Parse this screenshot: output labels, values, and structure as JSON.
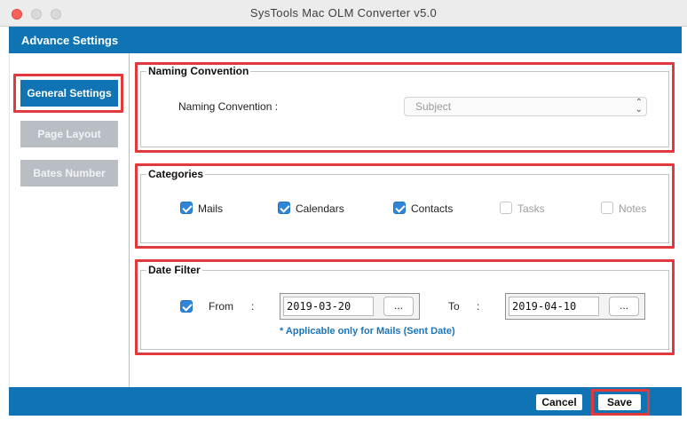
{
  "window": {
    "title": "SysTools Mac OLM Converter v5.0"
  },
  "header": {
    "title": "Advance Settings"
  },
  "sidebar": {
    "items": [
      {
        "label": "General Settings",
        "active": true
      },
      {
        "label": "Page Layout",
        "active": false
      },
      {
        "label": "Bates Number",
        "active": false
      }
    ]
  },
  "naming": {
    "group_title": "Naming Convention",
    "field_label": "Naming Convention :",
    "selected": "Subject"
  },
  "categories": {
    "group_title": "Categories",
    "items": [
      {
        "label": "Mails",
        "checked": true,
        "enabled": true
      },
      {
        "label": "Calendars",
        "checked": true,
        "enabled": true
      },
      {
        "label": "Contacts",
        "checked": true,
        "enabled": true
      },
      {
        "label": "Tasks",
        "checked": false,
        "enabled": false
      },
      {
        "label": "Notes",
        "checked": false,
        "enabled": false
      }
    ]
  },
  "date_filter": {
    "group_title": "Date Filter",
    "enabled": true,
    "from_label": "From",
    "to_label": "To",
    "colon": ":",
    "from_value": "2019-03-20",
    "to_value": "2019-04-10",
    "picker_label": "...",
    "note": "* Applicable only for Mails (Sent Date)"
  },
  "footer": {
    "cancel_label": "Cancel",
    "save_label": "Save"
  },
  "colors": {
    "accent": "#0f73b4",
    "highlight": "#e4393c",
    "checkbox": "#2f86d8",
    "disabled_button": "#b9bec4"
  }
}
